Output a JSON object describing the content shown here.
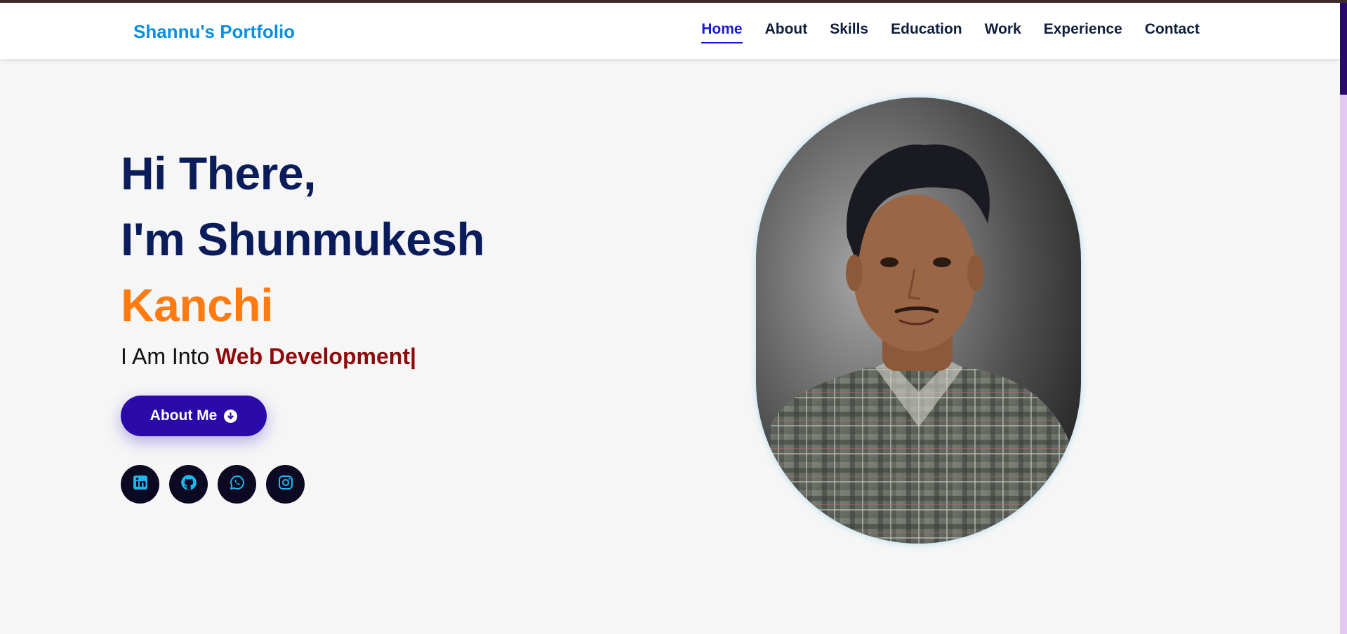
{
  "header": {
    "logo": "Shannu's Portfolio",
    "nav": [
      {
        "label": "Home",
        "active": true
      },
      {
        "label": "About",
        "active": false
      },
      {
        "label": "Skills",
        "active": false
      },
      {
        "label": "Education",
        "active": false
      },
      {
        "label": "Work",
        "active": false
      },
      {
        "label": "Experience",
        "active": false
      },
      {
        "label": "Contact",
        "active": false
      }
    ]
  },
  "hero": {
    "line1": "Hi There,",
    "line2": "I'm Shunmukesh",
    "name": "Kanchi",
    "tagline_prefix": "I Am Into ",
    "tagline_typed": "Web Development",
    "cursor": "|",
    "button_label": "About Me",
    "button_icon": "arrow-circle-down-icon"
  },
  "socials": [
    {
      "name": "linkedin",
      "icon": "linkedin-icon"
    },
    {
      "name": "github",
      "icon": "github-icon"
    },
    {
      "name": "whatsapp",
      "icon": "whatsapp-icon"
    },
    {
      "name": "instagram",
      "icon": "instagram-icon"
    }
  ],
  "portrait": {
    "icon": "profile-photo"
  },
  "colors": {
    "logo": "#0a8fe0",
    "heading": "#0a1d5a",
    "name": "#ff7b12",
    "typed": "#8e0a0a",
    "button": "#2a0aa8",
    "nav_active": "#1a1ad6",
    "social_bg": "#0c0a22",
    "social_icon": "#1fb6f0"
  }
}
